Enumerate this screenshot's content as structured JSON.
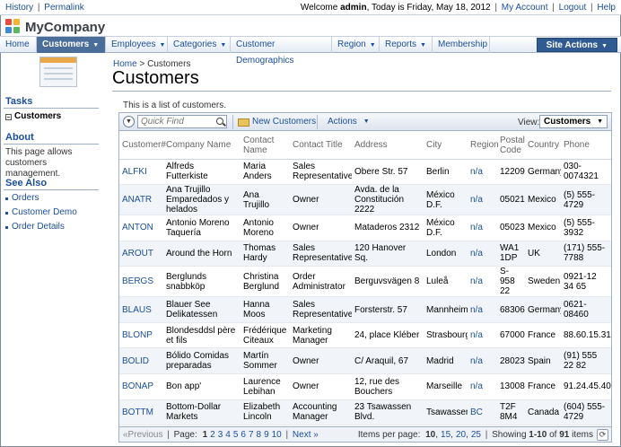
{
  "topbar": {
    "history": "History",
    "permalink": "Permalink",
    "welcome_prefix": "Welcome ",
    "user": "admin",
    "welcome_suffix": ", Today is Friday, May 18, 2012",
    "my_account": "My Account",
    "logout": "Logout",
    "help": "Help"
  },
  "app": {
    "name": "MyCompany"
  },
  "nav": {
    "items": [
      {
        "label": "Home"
      },
      {
        "label": "Customers"
      },
      {
        "label": "Employees"
      },
      {
        "label": "Categories"
      },
      {
        "label": "Customer Demographics"
      },
      {
        "label": "Region"
      },
      {
        "label": "Reports"
      },
      {
        "label": "Membership"
      }
    ],
    "site_actions": "Site Actions"
  },
  "sidebar": {
    "tasks_title": "Tasks",
    "task_item": "Customers",
    "about_title": "About",
    "about_text": "This page allows customers management.",
    "see_also_title": "See Also",
    "see_also": [
      "Orders",
      "Customer Demo",
      "Order Details"
    ]
  },
  "main": {
    "breadcrumb_home": "Home",
    "breadcrumb_sep": ">",
    "breadcrumb_current": "Customers",
    "title": "Customers",
    "description": "This is a list of customers."
  },
  "toolbar": {
    "quick_find_placeholder": "Quick Find",
    "new_customers": "New Customers",
    "actions": "Actions",
    "view_label": "View:",
    "view_value": "Customers"
  },
  "table": {
    "headers": [
      "Customer#",
      "Company Name",
      "Contact Name",
      "Contact Title",
      "Address",
      "City",
      "Region",
      "Postal Code",
      "Country",
      "Phone"
    ],
    "rows": [
      [
        "ALFKI",
        "Alfreds Futterkiste",
        "Maria Anders",
        "Sales Representative",
        "Obere Str. 57",
        "Berlin",
        "n/a",
        "12209",
        "Germany",
        "030-0074321"
      ],
      [
        "ANATR",
        "Ana Trujillo Emparedados y helados",
        "Ana Trujillo",
        "Owner",
        "Avda. de la Constitución 2222",
        "México D.F.",
        "n/a",
        "05021",
        "Mexico",
        "(5) 555-4729"
      ],
      [
        "ANTON",
        "Antonio Moreno Taquería",
        "Antonio Moreno",
        "Owner",
        "Mataderos 2312",
        "México D.F.",
        "n/a",
        "05023",
        "Mexico",
        "(5) 555-3932"
      ],
      [
        "AROUT",
        "Around the Horn",
        "Thomas Hardy",
        "Sales Representative",
        "120 Hanover Sq.",
        "London",
        "n/a",
        "WA1 1DP",
        "UK",
        "(171) 555-7788"
      ],
      [
        "BERGS",
        "Berglunds snabbköp",
        "Christina Berglund",
        "Order Administrator",
        "Berguvsvägen 8",
        "Luleå",
        "n/a",
        "S-958 22",
        "Sweden",
        "0921-12 34 65"
      ],
      [
        "BLAUS",
        "Blauer See Delikatessen",
        "Hanna Moos",
        "Sales Representative",
        "Forsterstr. 57",
        "Mannheim",
        "n/a",
        "68306",
        "Germany",
        "0621-08460"
      ],
      [
        "BLONP",
        "Blondesddsl père et fils",
        "Frédérique Citeaux",
        "Marketing Manager",
        "24, place Kléber",
        "Strasbourg",
        "n/a",
        "67000",
        "France",
        "88.60.15.31"
      ],
      [
        "BOLID",
        "Bólido Comidas preparadas",
        "Martín Sommer",
        "Owner",
        "C/ Araquil, 67",
        "Madrid",
        "n/a",
        "28023",
        "Spain",
        "(91) 555 22 82"
      ],
      [
        "BONAP",
        "Bon app'",
        "Laurence Lebihan",
        "Owner",
        "12, rue des Bouchers",
        "Marseille",
        "n/a",
        "13008",
        "France",
        "91.24.45.40"
      ],
      [
        "BOTTM",
        "Bottom-Dollar Markets",
        "Elizabeth Lincoln",
        "Accounting Manager",
        "23 Tsawassen Blvd.",
        "Tsawassen",
        "BC",
        "T2F 8M4",
        "Canada",
        "(604) 555-4729"
      ]
    ]
  },
  "pager": {
    "previous": "«Previous",
    "page_label": "Page:",
    "pages": [
      "1",
      "2",
      "3",
      "4",
      "5",
      "6",
      "7",
      "8",
      "9",
      "10"
    ],
    "next": "Next »",
    "items_label": "Items per page:",
    "sizes": [
      "10",
      "15",
      "20",
      "25"
    ],
    "showing_prefix": "Showing ",
    "showing_range": "1-10",
    "showing_of": " of ",
    "total": "91",
    "showing_suffix": " items"
  }
}
